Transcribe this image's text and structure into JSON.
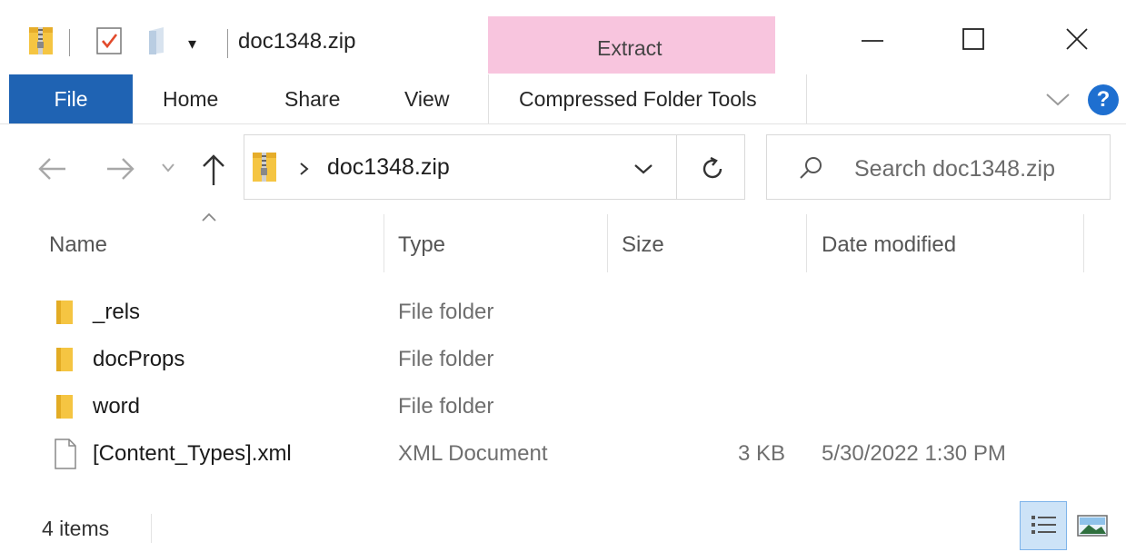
{
  "window": {
    "title": "doc1348.zip"
  },
  "context_tab": {
    "label": "Extract",
    "color": "#f8c5de"
  },
  "ribbon": {
    "tabs": [
      "File",
      "Home",
      "Share",
      "View",
      "Compressed Folder Tools"
    ],
    "help_label": "?"
  },
  "address": {
    "path_segment": "doc1348.zip"
  },
  "search": {
    "placeholder": "Search doc1348.zip"
  },
  "columns": [
    "Name",
    "Type",
    "Size",
    "Date modified"
  ],
  "files": [
    {
      "name": "_rels",
      "type": "File folder",
      "size": "",
      "date": "",
      "icon": "folder-icon"
    },
    {
      "name": "docProps",
      "type": "File folder",
      "size": "",
      "date": "",
      "icon": "folder-icon"
    },
    {
      "name": "word",
      "type": "File folder",
      "size": "",
      "date": "",
      "icon": "folder-icon"
    },
    {
      "name": "[Content_Types].xml",
      "type": "XML Document",
      "size": "3 KB",
      "date": "5/30/2022 1:30 PM",
      "icon": "document-icon"
    }
  ],
  "status": {
    "items": "4 items"
  },
  "colors": {
    "accent": "#1f63b3",
    "folder": "#f5c542"
  }
}
